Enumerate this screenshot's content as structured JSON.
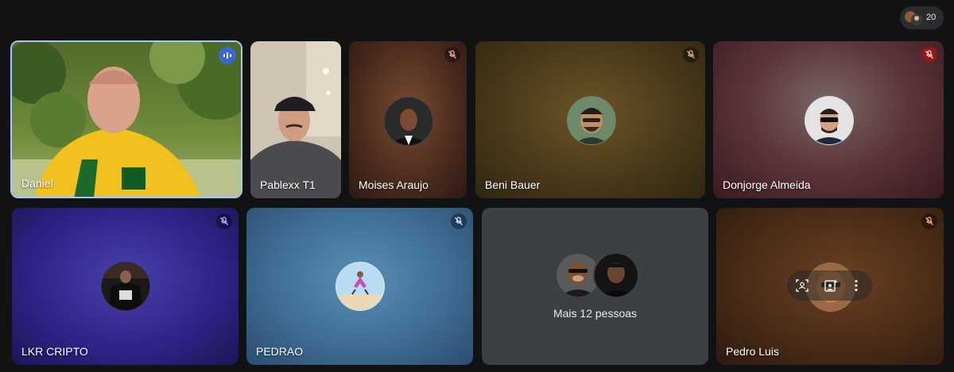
{
  "participants_count": "20",
  "tiles": [
    {
      "name": "Daniel"
    },
    {
      "name": "Pablexx T1"
    },
    {
      "name": "Moises Araujo"
    },
    {
      "name": "Beni Bauer"
    },
    {
      "name": "Donjorge Almeida"
    },
    {
      "name": "LKR CRIPTO"
    },
    {
      "name": "PEDRAO"
    },
    {
      "name": "Mais 12 pessoas"
    },
    {
      "name": "Pedro Luis"
    }
  ],
  "icons": {
    "speaking": "audio-wave-icon",
    "muted": "mic-off-icon",
    "frame": "frame-person-icon",
    "effects": "visual-effects-icon",
    "more": "more-vert-icon"
  },
  "colors": {
    "background": "#111214",
    "active_speaker_border": "#a8c7fa",
    "speaking_badge": "#3c65d4",
    "muted_red": "#8b1a1a",
    "muted_dark": "rgba(0,0,0,0.35)"
  }
}
